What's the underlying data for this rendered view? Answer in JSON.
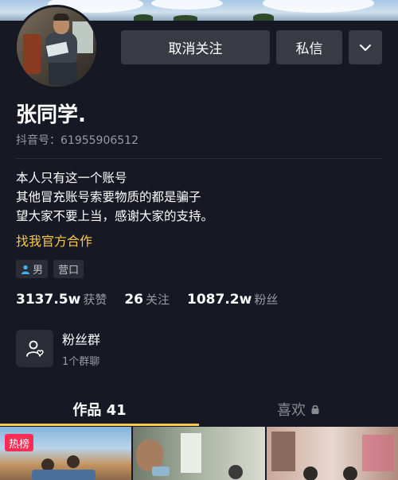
{
  "profile": {
    "name": "张同学.",
    "douyin_id": "抖音号：61955906512",
    "bio_lines": [
      "本人只有这一个账号",
      "其他冒充账号索要物质的都是骗子",
      "望大家不要上当，感谢大家的支持。"
    ],
    "collab_link": "找我官方合作",
    "tags": [
      {
        "icon": "male-icon",
        "label": "男"
      },
      {
        "icon": "",
        "label": "营口"
      }
    ]
  },
  "actions": {
    "unfollow_label": "取消关注",
    "message_label": "私信",
    "more_icon": "chevron-down-icon"
  },
  "stats": [
    {
      "value": "3137.5w",
      "label": "获赞"
    },
    {
      "value": "26",
      "label": "关注"
    },
    {
      "value": "1087.2w",
      "label": "粉丝"
    }
  ],
  "fans_group": {
    "icon": "group-heart-icon",
    "title": "粉丝群",
    "subtitle": "1个群聊"
  },
  "tabs": {
    "works": "作品 41",
    "likes": "喜欢",
    "likes_icon": "lock-icon"
  },
  "grid": {
    "hot_badge": "热榜"
  },
  "colors": {
    "background": "#161823",
    "button": "#393b44",
    "accent_yellow": "#f8c84a",
    "hot_red": "#fe2c55",
    "male_blue": "#3bb6ff"
  }
}
